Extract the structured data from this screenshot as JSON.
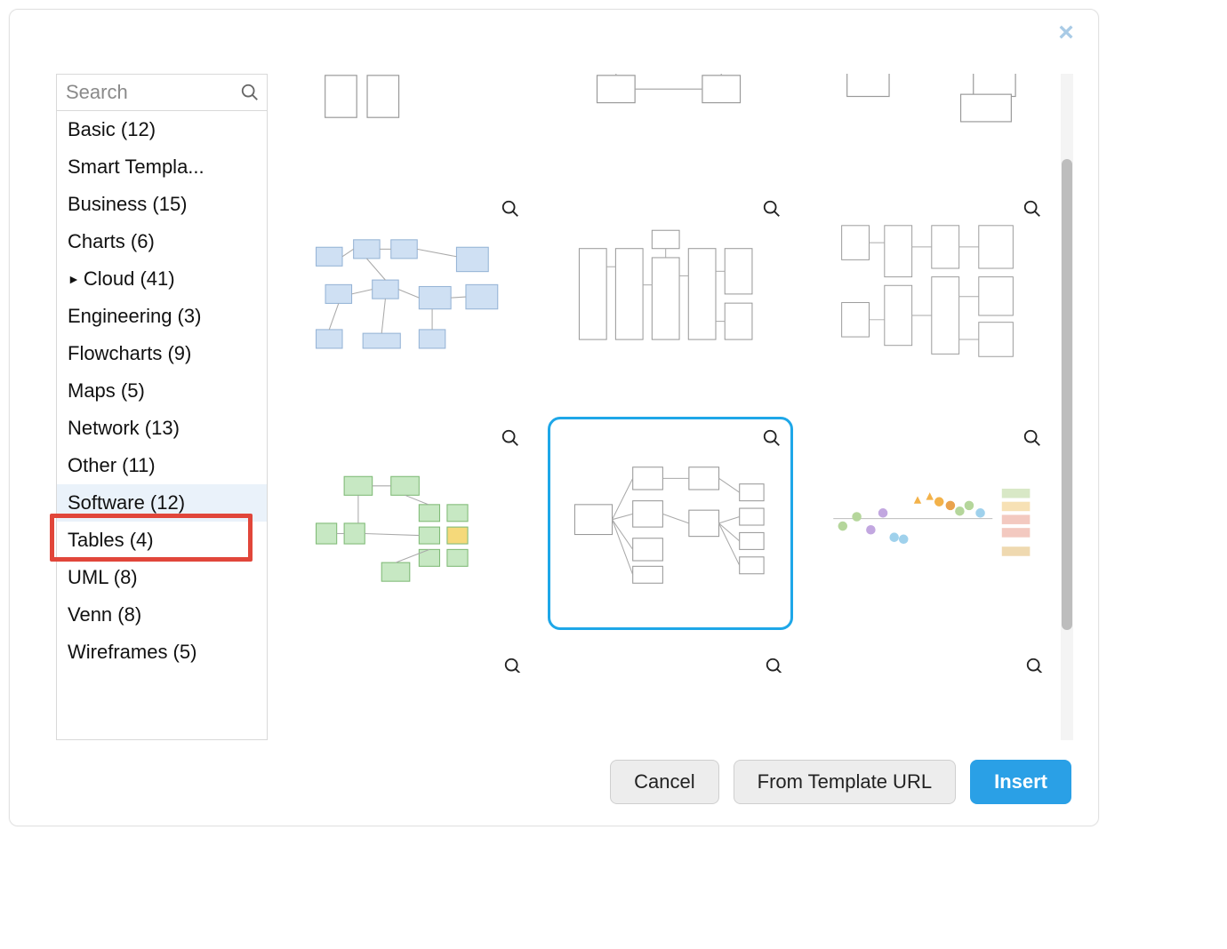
{
  "close_glyph": "×",
  "search": {
    "placeholder": "Search"
  },
  "categories": [
    {
      "label": "Basic (12)",
      "expandable": false,
      "selected": false
    },
    {
      "label": "Smart Templa...",
      "expandable": false,
      "selected": false
    },
    {
      "label": "Business (15)",
      "expandable": false,
      "selected": false
    },
    {
      "label": "Charts (6)",
      "expandable": false,
      "selected": false
    },
    {
      "label": "Cloud (41)",
      "expandable": true,
      "selected": false
    },
    {
      "label": "Engineering (3)",
      "expandable": false,
      "selected": false
    },
    {
      "label": "Flowcharts (9)",
      "expandable": false,
      "selected": false
    },
    {
      "label": "Maps (5)",
      "expandable": false,
      "selected": false
    },
    {
      "label": "Network (13)",
      "expandable": false,
      "selected": false
    },
    {
      "label": "Other (11)",
      "expandable": false,
      "selected": false
    },
    {
      "label": "Software (12)",
      "expandable": false,
      "selected": true,
      "highlighted": true
    },
    {
      "label": "Tables (4)",
      "expandable": false,
      "selected": false
    },
    {
      "label": "UML (8)",
      "expandable": false,
      "selected": false
    },
    {
      "label": "Venn (8)",
      "expandable": false,
      "selected": false
    },
    {
      "label": "Wireframes (5)",
      "expandable": false,
      "selected": false
    }
  ],
  "templates_row1": [
    {
      "style": "blue",
      "selected": false
    },
    {
      "style": "grey",
      "selected": false
    },
    {
      "style": "grey",
      "selected": false
    }
  ],
  "templates_row2": [
    {
      "style": "green",
      "selected": false
    },
    {
      "style": "grey",
      "selected": true
    },
    {
      "style": "colorful",
      "selected": false
    }
  ],
  "footer": {
    "cancel": "Cancel",
    "from_url": "From Template URL",
    "insert": "Insert"
  }
}
